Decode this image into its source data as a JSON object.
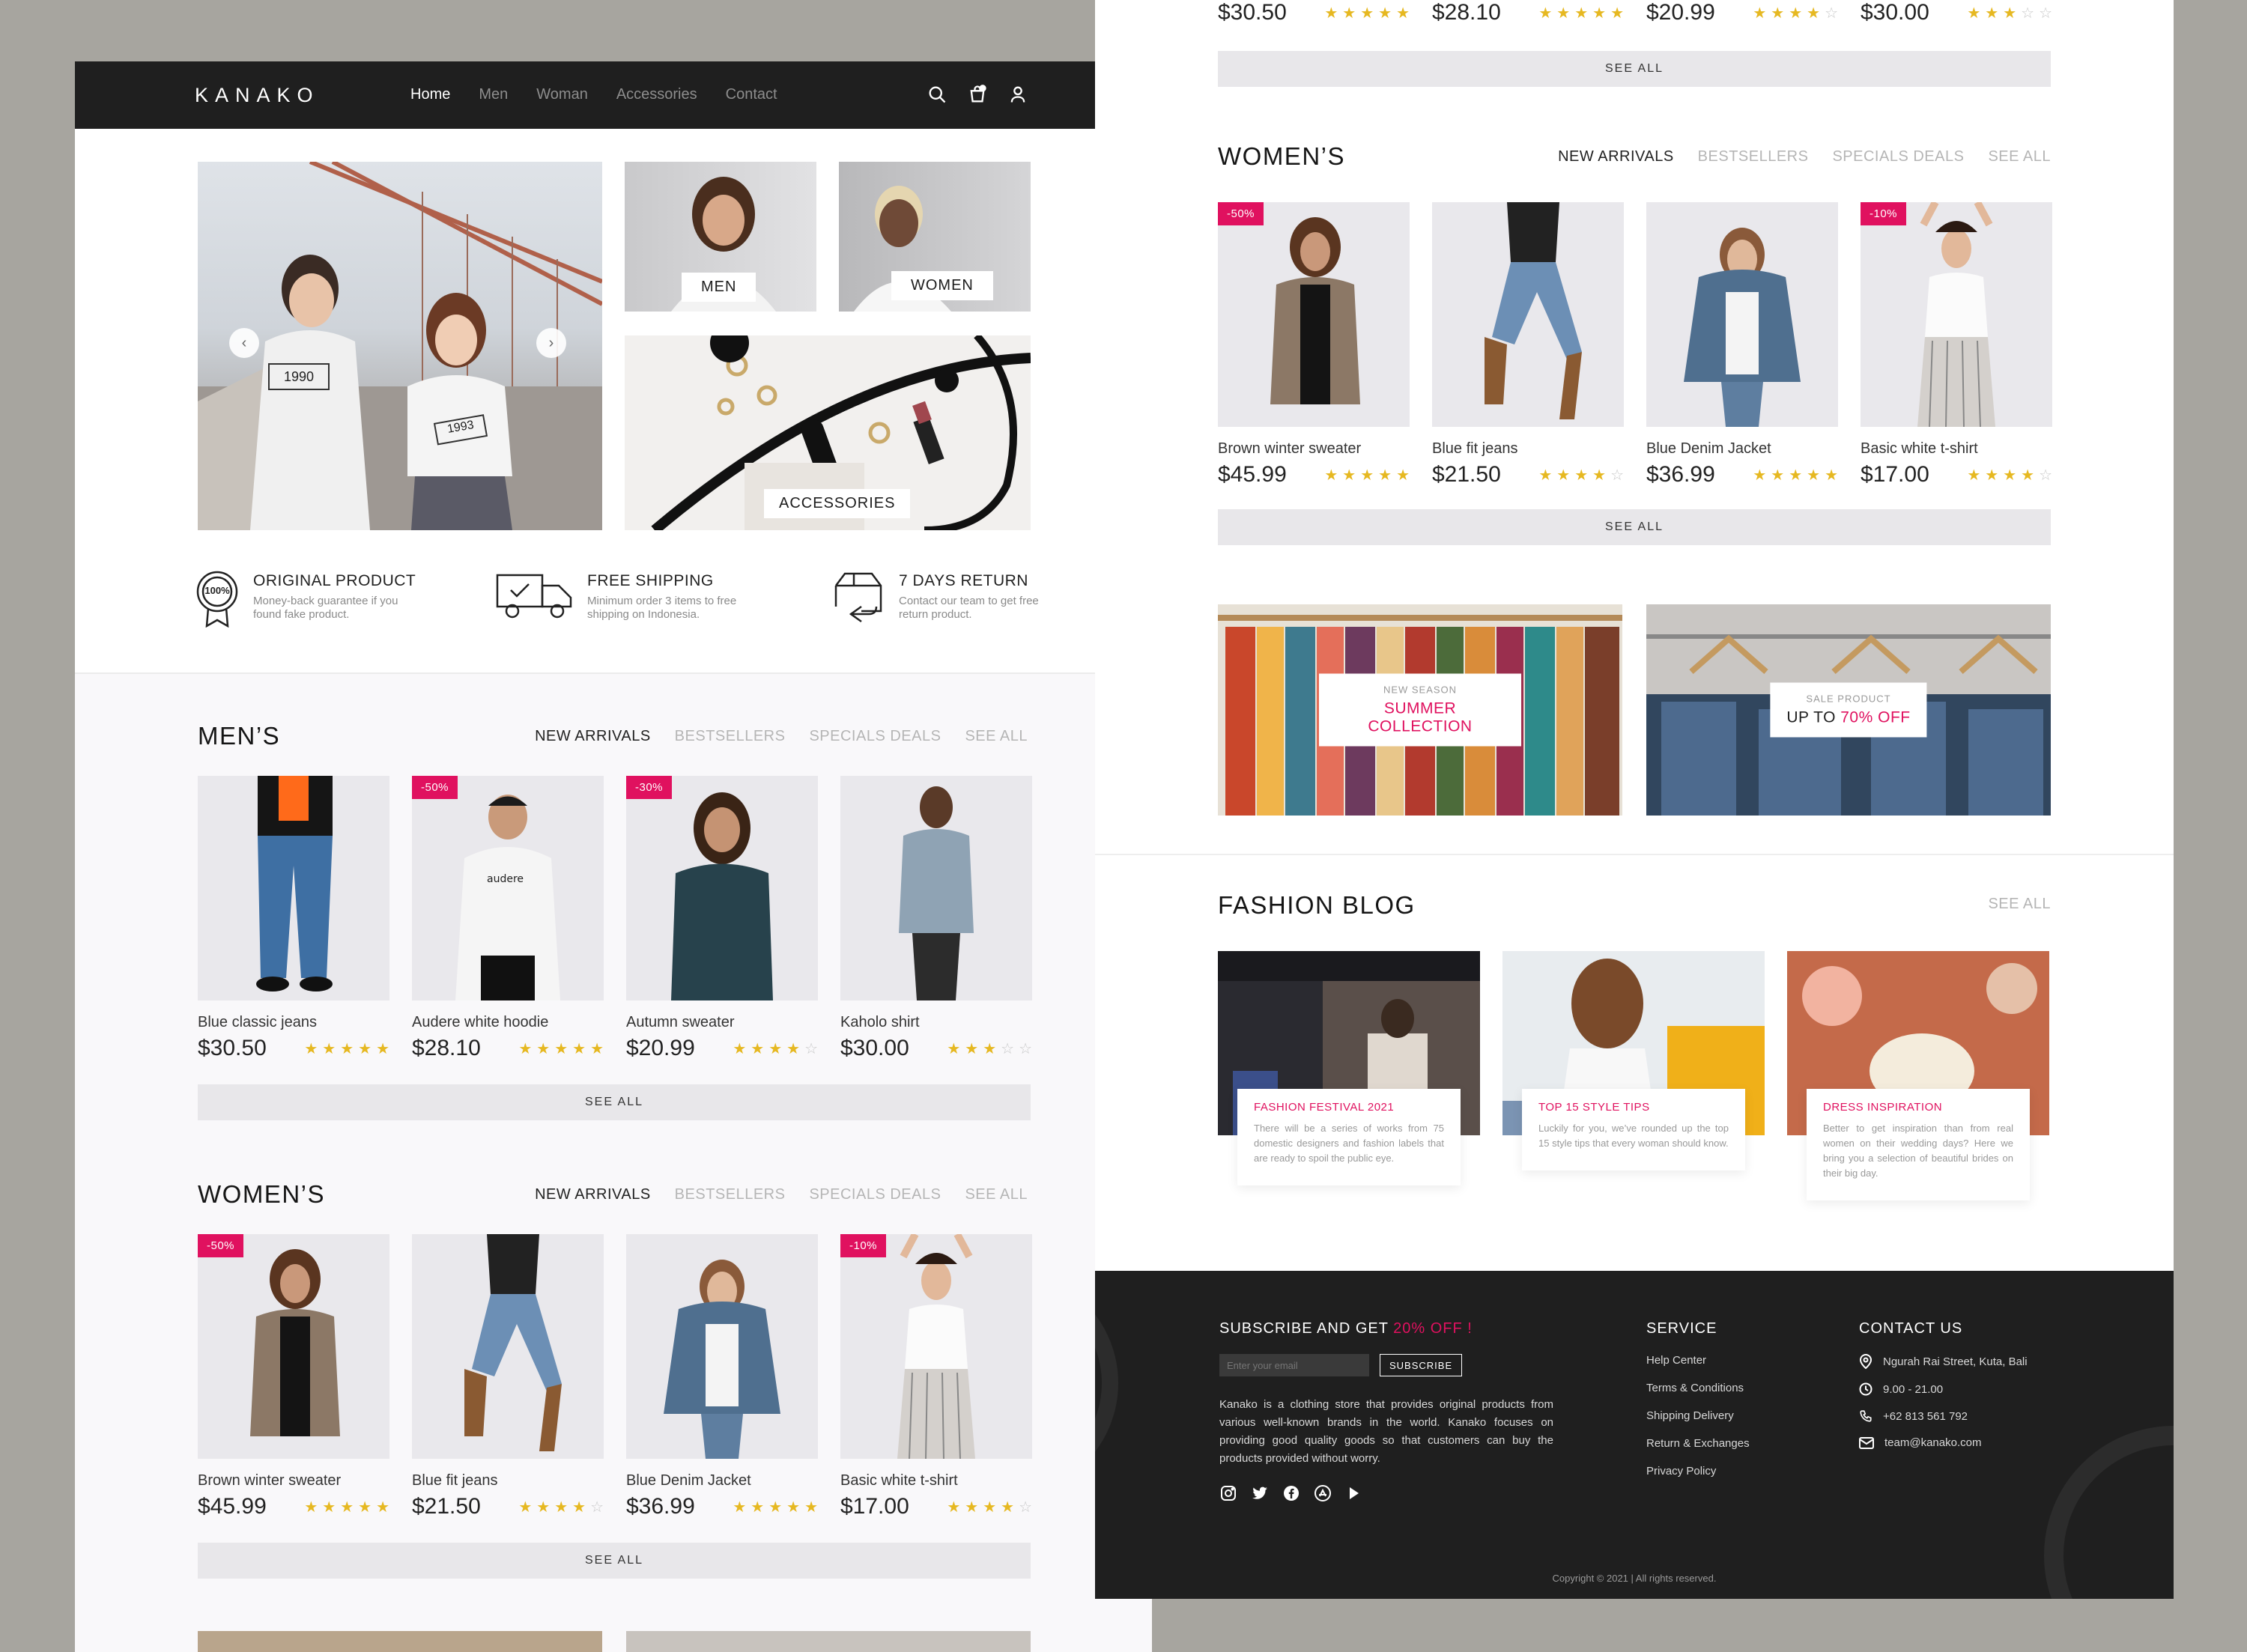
{
  "brand": "KANAKO",
  "nav": [
    "Home",
    "Men",
    "Woman",
    "Accessories",
    "Contact"
  ],
  "hero": {
    "tee_1": "1990",
    "tee_2": "1993",
    "men": "MEN",
    "women": "WOMEN",
    "accessories": "ACCESSORIES"
  },
  "features": [
    {
      "title": "ORIGINAL PRODUCT",
      "desc": "Money-back guarantee if you found fake product.",
      "badge": "100%"
    },
    {
      "title": "FREE SHIPPING",
      "desc": "Minimum order 3 items to free shipping on Indonesia."
    },
    {
      "title": "7 DAYS RETURN",
      "desc": "Contact our team to get free return product."
    }
  ],
  "filters": {
    "new": "NEW ARRIVALS",
    "best": "BESTSELLERS",
    "special": "SPECIALS DEALS",
    "seeall": "SEE ALL"
  },
  "mens": {
    "title": "MEN’S",
    "products": [
      {
        "name": "Blue classic jeans",
        "price": "$30.50",
        "rating": 5,
        "sale": ""
      },
      {
        "name": "Audere white hoodie",
        "price": "$28.10",
        "rating": 5,
        "sale": "-50%"
      },
      {
        "name": "Autumn sweater",
        "price": "$20.99",
        "rating": 4,
        "sale": "-30%"
      },
      {
        "name": "Kaholo shirt",
        "price": "$30.00",
        "rating": 3,
        "sale": ""
      }
    ]
  },
  "womens": {
    "title": "WOMEN’S",
    "products": [
      {
        "name": "Brown winter sweater",
        "price": "$45.99",
        "rating": 5,
        "sale": "-50%"
      },
      {
        "name": "Blue fit jeans",
        "price": "$21.50",
        "rating": 4,
        "sale": ""
      },
      {
        "name": "Blue Denim Jacket",
        "price": "$36.99",
        "rating": 5,
        "sale": ""
      },
      {
        "name": "Basic white t-shirt",
        "price": "$17.00",
        "rating": 4,
        "sale": "-10%"
      }
    ]
  },
  "top_prices": [
    "$30.50",
    "$28.10",
    "$20.99",
    "$30.00"
  ],
  "see_all": "SEE ALL",
  "promos": [
    {
      "small": "NEW SEASON",
      "big_pre": "",
      "big_accent": "SUMMER COLLECTION"
    },
    {
      "small": "SALE PRODUCT",
      "big_pre": "UP TO ",
      "big_accent": "70% OFF"
    }
  ],
  "blog": {
    "title": "FASHION BLOG",
    "posts": [
      {
        "title": "FASHION FESTIVAL 2021",
        "text": "There will be a series of works from 75 domestic designers and fashion labels that are ready to spoil the public eye."
      },
      {
        "title": "TOP 15 STYLE TIPS",
        "text": "Luckily for you, we’ve rounded up the top 15 style tips that every woman should know."
      },
      {
        "title": "DRESS INSPIRATION",
        "text": "Better to get inspiration than from real women on their wedding days? Here we bring you a selection of beautiful brides on their big day."
      }
    ]
  },
  "footer": {
    "subscribe_pre": "SUBSCRIBE AND GET ",
    "subscribe_accent": "20% OFF !",
    "email_placeholder": "Enter your email",
    "subscribe_btn": "SUBSCRIBE",
    "about": "Kanako is a clothing store that provides original products from various well-known brands in the world. Kanako focuses on providing good quality goods so that customers can buy the products provided without worry.",
    "service_title": "SERVICE",
    "service": [
      "Help Center",
      "Terms & Conditions",
      "Shipping Delivery",
      "Return & Exchanges",
      "Privacy Policy"
    ],
    "contact_title": "CONTACT US",
    "contact": [
      {
        "icon": "location-icon",
        "text": "Ngurah Rai Street, Kuta, Bali"
      },
      {
        "icon": "clock-icon",
        "text": "9.00 - 21.00"
      },
      {
        "icon": "phone-icon",
        "text": "+62 813 561 792"
      },
      {
        "icon": "mail-icon",
        "text": "team@kanako.com"
      }
    ],
    "copyright": "Copyright © 2021 | All rights reserved."
  },
  "colors": {
    "accent": "#e0115f",
    "dark": "#1f1f1f",
    "star": "#e6b821",
    "tile": "#e9e8ec"
  }
}
